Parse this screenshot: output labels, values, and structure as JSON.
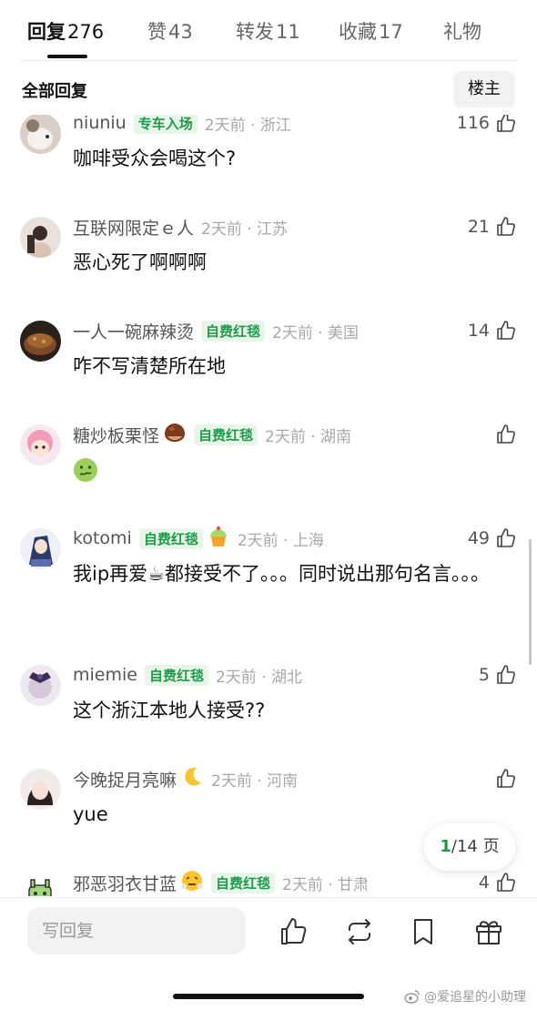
{
  "tabs": [
    {
      "label": "回复",
      "count": "276",
      "active": true
    },
    {
      "label": "赞",
      "count": "43"
    },
    {
      "label": "转发",
      "count": "11"
    },
    {
      "label": "收藏",
      "count": "17"
    },
    {
      "label": "礼物",
      "count": ""
    }
  ],
  "subheader": {
    "title": "全部回复",
    "op_button": "楼主"
  },
  "comments": [
    {
      "name": "niuniu",
      "badge": "专车入场",
      "time": "2天前 · 浙江",
      "likes": "116",
      "text": "咖啡受众会喝这个?"
    },
    {
      "name": "互联网限定ｅ人",
      "badge": "",
      "time": "2天前 · 江苏",
      "likes": "21",
      "text": "恶心死了啊啊啊"
    },
    {
      "name": "一人一碗麻辣烫",
      "badge": "自费红毯",
      "time": "2天前 · 美国",
      "likes": "14",
      "text": "咋不写清楚所在地"
    },
    {
      "name": "糖炒板栗怪",
      "name_emoji": "chestnut-emoji",
      "badge": "自费红毯",
      "time": "2天前 · 湖南",
      "likes": "",
      "text": "",
      "text_emoji": "nauseated-face-emoji"
    },
    {
      "name": "kotomi",
      "badge": "自费红毯",
      "badge_emoji": "cupcake-emoji",
      "time": "2天前 · 上海",
      "likes": "49",
      "text": "我ip再爱☕都接受不了。。。同时说出那句名言。。。"
    },
    {
      "name": "miemie",
      "badge": "自费红毯",
      "time": "2天前 · 湖北",
      "likes": "5",
      "text": "这个浙江本地人接受??"
    },
    {
      "name": "今晚捉月亮嘛",
      "name_emoji": "crescent-moon-emoji",
      "badge": "",
      "time": "2天前 · 河南",
      "likes": "",
      "text": "yue"
    },
    {
      "name": "邪恶羽衣甘蓝",
      "name_emoji": "steam-face-emoji",
      "badge": "自费红毯",
      "time": "2天前 · 甘肃",
      "likes": "4",
      "text": ""
    }
  ],
  "page_indicator": {
    "current": "1",
    "rest": "/14 页"
  },
  "bottom_bar": {
    "reply_placeholder": "写回复",
    "icons": [
      "like-icon",
      "repost-icon",
      "bookmark-icon",
      "gift-icon"
    ]
  },
  "watermark": "@爱追星的小助理",
  "colors": {
    "accent_green": "#1f9a4a",
    "badge_bg": "#e8f6ea",
    "muted_text": "#a8a8a8"
  }
}
